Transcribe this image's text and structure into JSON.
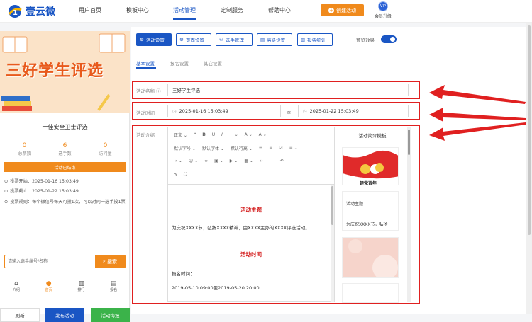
{
  "brand": {
    "name": "壹云微"
  },
  "nav": [
    {
      "label": "用户首页"
    },
    {
      "label": "模板中心"
    },
    {
      "label": "活动管理"
    },
    {
      "label": "定制服务"
    },
    {
      "label": "帮助中心"
    }
  ],
  "header": {
    "create_button": "创建活动",
    "vip_badge": "VIP",
    "vip_label": "会员升级"
  },
  "preview_phone": {
    "banner_title": "三好学生评选",
    "activity_title": "十佳安全卫士评选",
    "stats": [
      {
        "value": "0",
        "label": "总票数"
      },
      {
        "value": "6",
        "label": "选手数"
      },
      {
        "value": "0",
        "label": "访问量"
      }
    ],
    "status_bar": "活动已结束",
    "vote_start": "投票开始：2025-01-16 15:03:49",
    "vote_end": "投票截止：2025-01-22 15:03:49",
    "vote_rule": "投票规则：每个微信号每天可投1次，可以对同一选手投1票",
    "search_placeholder": "请输入选手编号/名称",
    "search_button": "搜索",
    "tabs": [
      {
        "label": "介绍"
      },
      {
        "label": "首页"
      },
      {
        "label": "排行"
      },
      {
        "label": "报名"
      }
    ],
    "refresh_button": "刷新",
    "publish_button": "发布活动",
    "poster_button": "活动海报"
  },
  "toolbar": {
    "buttons": [
      {
        "label": "活动设置"
      },
      {
        "label": "页面设置"
      },
      {
        "label": "选手管理"
      },
      {
        "label": "高级设置"
      },
      {
        "label": "投票统计"
      }
    ],
    "preview_label": "预览效果"
  },
  "subtabs": [
    {
      "label": "基本设置"
    },
    {
      "label": "报名设置"
    },
    {
      "label": "其它设置"
    }
  ],
  "form": {
    "name_label": "活动名称",
    "name_value": "三好学生评选",
    "time_label": "活动时间",
    "time_start": "2025-01-16 15:03:49",
    "time_sep": "至",
    "time_end": "2025-01-22 15:03:49",
    "intro_label": "活动介绍"
  },
  "editor": {
    "toolbar_row1": [
      "正文",
      "❝",
      "B",
      "U",
      "I",
      "···",
      "A",
      "A"
    ],
    "toolbar_row2": [
      "默认字号",
      "默认字体",
      "默认行高"
    ],
    "heading1": "活动主题",
    "para1": "为庆祝XXXX节，弘扬XXXX精神，由XXXX主办的XXXX评选活动。",
    "heading2": "活动时间",
    "para2": "报名时间：",
    "para3": "2019-05-10 09:00至2019-05-20 20:00"
  },
  "templates": {
    "title": "活动简介模板",
    "card1_caption": "建党百年",
    "card2_title": "活动主题",
    "card2_body": "为庆祝XXXX节，弘扬"
  },
  "colors": {
    "brand_blue": "#1a56c4",
    "orange": "#f08a1c",
    "highlight_red": "#e02020"
  }
}
